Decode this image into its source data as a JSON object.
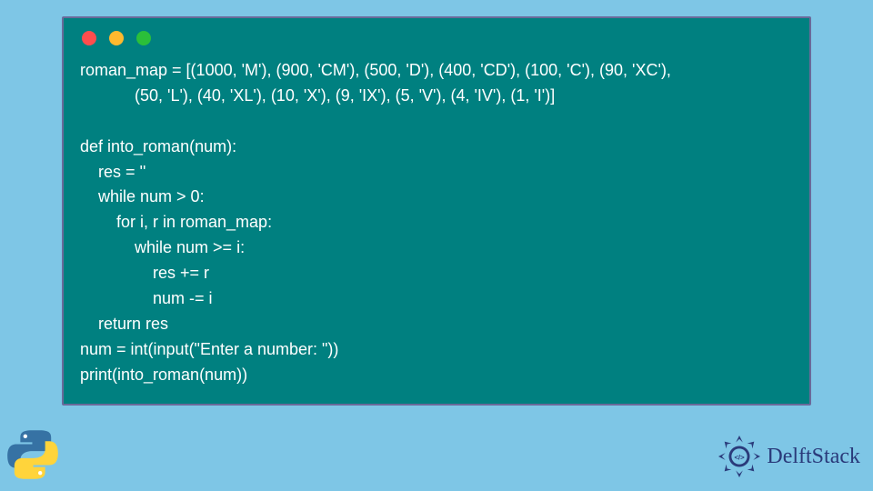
{
  "code": {
    "lines": [
      "roman_map = [(1000, 'M'), (900, 'CM'), (500, 'D'), (400, 'CD'), (100, 'C'), (90, 'XC'),",
      "            (50, 'L'), (40, 'XL'), (10, 'X'), (9, 'IX'), (5, 'V'), (4, 'IV'), (1, 'I')]",
      "",
      "def into_roman(num):",
      "    res = ''",
      "    while num > 0:",
      "        for i, r in roman_map:",
      "            while num >= i:",
      "                res += r",
      "                num -= i",
      "    return res",
      "num = int(input(\"Enter a number: \"))",
      "print(into_roman(num))"
    ]
  },
  "branding": {
    "name": "DelftStack"
  },
  "window": {
    "dot_colors": {
      "red": "#ff4d4d",
      "yellow": "#ffb92e",
      "green": "#2bbf3a"
    }
  }
}
